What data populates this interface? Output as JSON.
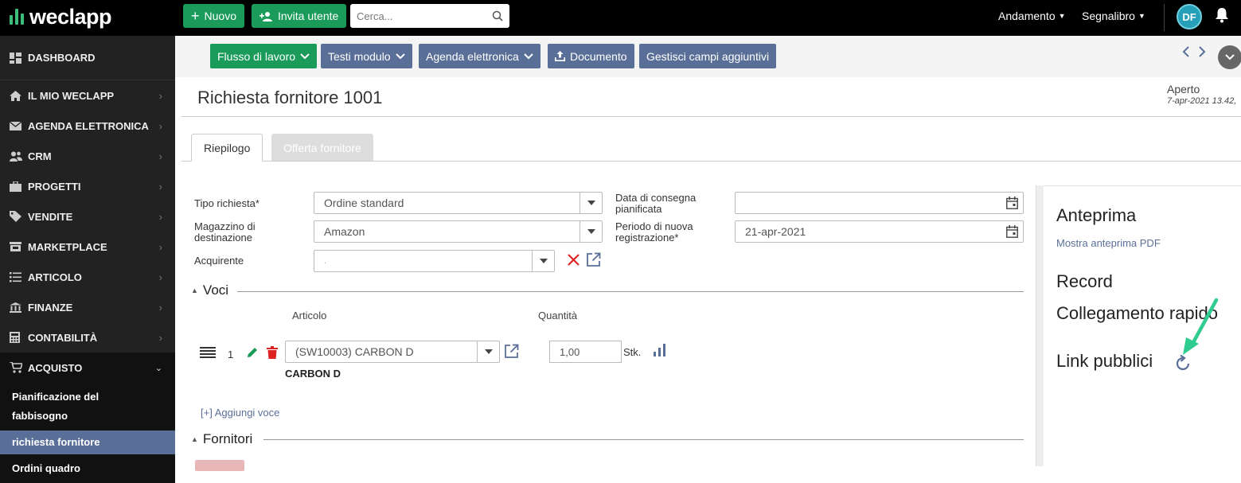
{
  "topbar": {
    "logo": "weclapp",
    "new_label": "Nuovo",
    "invite_label": "Invita utente",
    "search_placeholder": "Cerca...",
    "andamento_label": "Andamento",
    "segnalibro_label": "Segnalibro",
    "avatar_initials": "DF"
  },
  "sidebar": {
    "items": [
      {
        "label": "DASHBOARD",
        "icon": "dashboard-icon"
      },
      {
        "label": "IL MIO WECLAPP",
        "icon": "home-icon"
      },
      {
        "label": "AGENDA ELETTRONICA",
        "icon": "mail-icon"
      },
      {
        "label": "CRM",
        "icon": "users-icon"
      },
      {
        "label": "PROGETTI",
        "icon": "briefcase-icon"
      },
      {
        "label": "VENDITE",
        "icon": "tag-icon"
      },
      {
        "label": "MARKETPLACE",
        "icon": "store-icon"
      },
      {
        "label": "ARTICOLO",
        "icon": "list-icon"
      },
      {
        "label": "FINANZE",
        "icon": "bank-icon"
      },
      {
        "label": "CONTABILITÀ",
        "icon": "calculator-icon"
      },
      {
        "label": "ACQUISTO",
        "icon": "cart-icon"
      }
    ],
    "sub_items": [
      {
        "label": "Pianificazione del fabbisogno"
      },
      {
        "label": "richiesta fornitore"
      },
      {
        "label": "Ordini quadro"
      }
    ]
  },
  "toolbar": {
    "workflow_label": "Flusso di lavoro",
    "templates_label": "Testi modulo",
    "agenda_label": "Agenda elettronica",
    "document_label": "Documento",
    "custom_fields_label": "Gestisci campi aggiuntivi"
  },
  "page": {
    "title": "Richiesta fornitore 1001",
    "status": "Aperto",
    "status_date": "7-apr-2021 13.42,",
    "tabs": [
      {
        "label": "Riepilogo"
      },
      {
        "label": "Offerta fornitore"
      }
    ]
  },
  "form": {
    "tipo_label": "Tipo richiesta*",
    "tipo_value": "Ordine standard",
    "magazzino_label": "Magazzino di destinazione",
    "magazzino_value": "Amazon",
    "acquirente_label": "Acquirente",
    "acquirente_value": ".",
    "consegna_label": "Data di consegna pianificata",
    "consegna_value": "",
    "periodo_label": "Periodo di nuova registrazione*",
    "periodo_value": "21-apr-2021"
  },
  "voci": {
    "title": "Voci",
    "col_articolo": "Articolo",
    "col_quantita": "Quantità",
    "row_number": "1",
    "article_value": "(SW10003) CARBON D",
    "article_name": "CARBON D",
    "quantity": "1,00",
    "unit": "Stk.",
    "add_label": "[+] Aggiungi voce"
  },
  "fornitori": {
    "title": "Fornitori"
  },
  "right_panel": {
    "preview_title": "Anteprima",
    "preview_link": "Mostra anteprima PDF",
    "record_title": "Record",
    "quicklink_title": "Collegamento rapido",
    "public_links_title": "Link pubblici"
  },
  "colors": {
    "accent_green": "#1a9b5a",
    "accent_blue": "#5a6f98",
    "annotation_arrow": "#2ecc8f"
  }
}
